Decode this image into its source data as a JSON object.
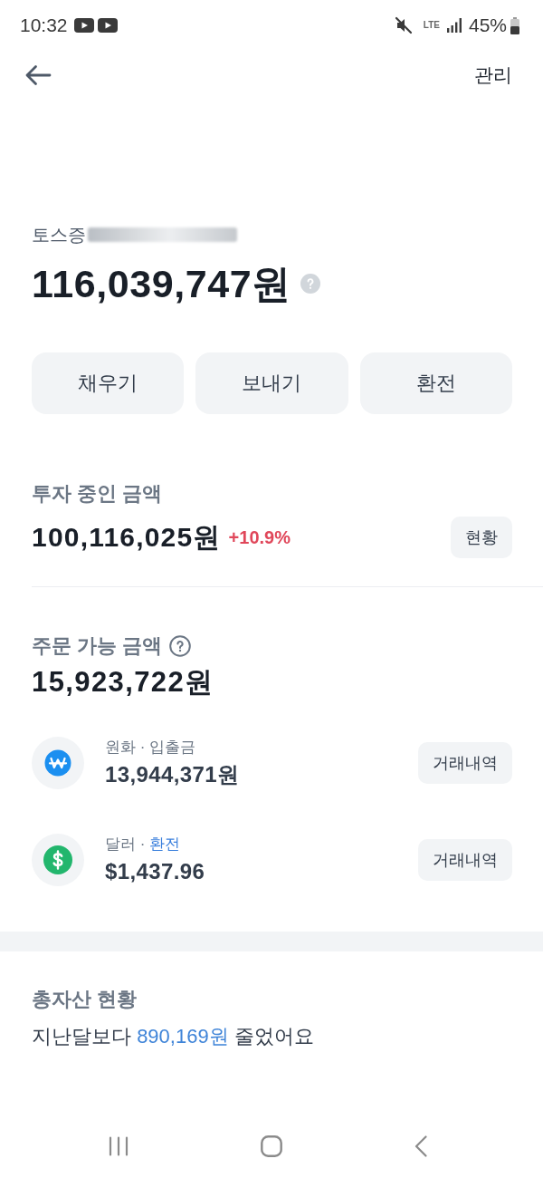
{
  "status_bar": {
    "time": "10:32",
    "network": "LTE",
    "battery": "45%"
  },
  "header": {
    "action": "관리"
  },
  "account": {
    "name": "토스증",
    "redacted": true
  },
  "total": {
    "amount": "116,039,747원"
  },
  "actions": [
    "채우기",
    "보내기",
    "환전"
  ],
  "invested": {
    "title": "투자 중인 금액",
    "amount": "100,116,025원",
    "change": "+10.9%",
    "rising": true,
    "button": "현황"
  },
  "orderable": {
    "title": "주문 가능 금액",
    "amount": "15,923,722원",
    "accounts": [
      {
        "kind": "won",
        "label": "원화",
        "separator": "·",
        "sub": "입출금",
        "sub_link": false,
        "amount": "13,944,371원",
        "button": "거래내역"
      },
      {
        "kind": "dollar",
        "label": "달러",
        "separator": "·",
        "sub": "환전",
        "sub_link": true,
        "amount": "$1,437.96",
        "button": "거래내역"
      }
    ]
  },
  "summary": {
    "title": "총자산 현황",
    "before": "지난달보다",
    "amount": "890,169원",
    "after": "줄었어요",
    "rising": false
  }
}
